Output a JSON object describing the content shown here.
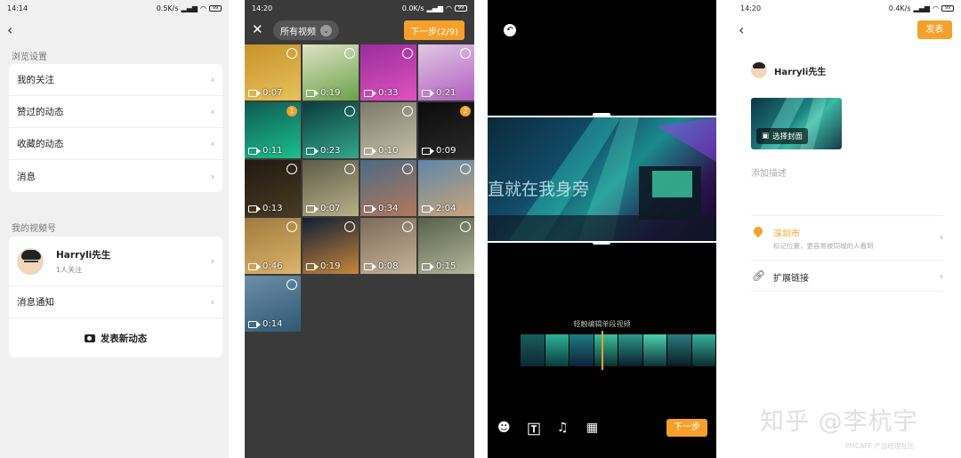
{
  "screen1": {
    "status": {
      "time": "14:14",
      "speed": "0.5K/s",
      "battery": "99"
    },
    "section_browse": "浏览设置",
    "browse_items": [
      "我的关注",
      "赞过的动态",
      "收藏的动态",
      "消息"
    ],
    "section_channel": "我的视频号",
    "profile": {
      "name": "Harryli先生",
      "followers": "1人关注"
    },
    "notify_label": "消息通知",
    "publish_label": "发表新动态"
  },
  "screen2": {
    "status": {
      "time": "14:20",
      "speed": "0.0K/s",
      "battery": "99"
    },
    "album_label": "所有视频",
    "next_label": "下一步(2/9)",
    "videos": [
      {
        "duration": "0:07",
        "badge": "",
        "colors": [
          "#c8922b",
          "#e7c25a"
        ]
      },
      {
        "duration": "0:19",
        "badge": "",
        "colors": [
          "#dfe2c3",
          "#6aa24a"
        ]
      },
      {
        "duration": "0:33",
        "badge": "",
        "colors": [
          "#9a2c9c",
          "#e053c0"
        ]
      },
      {
        "duration": "0:21",
        "badge": "",
        "colors": [
          "#e0c7e4",
          "#b15fbf"
        ]
      },
      {
        "duration": "0:11",
        "badge": "1",
        "colors": [
          "#0e5a52",
          "#1dbf8d"
        ]
      },
      {
        "duration": "0:23",
        "badge": "",
        "colors": [
          "#0b3b3d",
          "#33a88c"
        ]
      },
      {
        "duration": "0:10",
        "badge": "",
        "colors": [
          "#7d7a6c",
          "#c6c0a8"
        ]
      },
      {
        "duration": "0:09",
        "badge": "2",
        "colors": [
          "#0b0b0b",
          "#2a2a2a"
        ]
      },
      {
        "duration": "0:13",
        "badge": "",
        "colors": [
          "#201a12",
          "#4a3a22"
        ]
      },
      {
        "duration": "0:07",
        "badge": "",
        "colors": [
          "#5f5b48",
          "#b8b08a"
        ]
      },
      {
        "duration": "0:34",
        "badge": "",
        "colors": [
          "#4c6a85",
          "#b3785b"
        ]
      },
      {
        "duration": "2:04",
        "badge": "",
        "colors": [
          "#5e86a8",
          "#c9a57a"
        ]
      },
      {
        "duration": "0:46",
        "badge": "",
        "colors": [
          "#a07a3f",
          "#ddb46a"
        ]
      },
      {
        "duration": "0:19",
        "badge": "",
        "colors": [
          "#0f1d35",
          "#c8873b"
        ]
      },
      {
        "duration": "0:08",
        "badge": "",
        "colors": [
          "#7a6a58",
          "#c7b39a"
        ]
      },
      {
        "duration": "0:15",
        "badge": "",
        "colors": [
          "#56604a",
          "#b5b79a"
        ]
      },
      {
        "duration": "0:14",
        "badge": "",
        "colors": [
          "#6f8ea8",
          "#2e5873"
        ]
      }
    ]
  },
  "screen3": {
    "overlay_text": "直就在我身旁",
    "hint": "轻触编辑单段视频",
    "next_label": "下一步",
    "tool_icons": [
      "sticker-icon",
      "text-icon",
      "music-icon",
      "clip-icon"
    ]
  },
  "screen4": {
    "status": {
      "time": "14:20",
      "speed": "0.4K/s",
      "battery": "99"
    },
    "send_label": "发表",
    "user_name": "Harryli先生",
    "cover_label": "选择封面",
    "desc_placeholder": "添加描述",
    "location": {
      "city": "深圳市",
      "sub": "标记位置，更容易被同城的人看到"
    },
    "link_label": "扩展链接",
    "watermark": "知乎 @李杭宇",
    "watermark2": "PMCAFF 产品经理社区"
  },
  "accent": "#f5a02a"
}
